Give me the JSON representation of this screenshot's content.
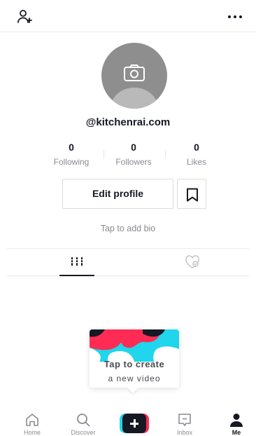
{
  "profile": {
    "username": "@kitchenrai.com",
    "bio_placeholder": "Tap to add bio",
    "edit_button": "Edit profile"
  },
  "stats": [
    {
      "value": "0",
      "label": "Following"
    },
    {
      "value": "0",
      "label": "Followers"
    },
    {
      "value": "0",
      "label": "Likes"
    }
  ],
  "tabs": [
    {
      "icon": "grid-bars-icon",
      "active": true
    },
    {
      "icon": "liked-heart-icon",
      "active": false
    }
  ],
  "create_card": {
    "line1": "Tap to create",
    "line2": "a new video"
  },
  "nav": {
    "items": [
      {
        "label": "Home",
        "icon": "home-icon"
      },
      {
        "label": "Discover",
        "icon": "search-icon"
      },
      {
        "label": "",
        "icon": "plus-icon"
      },
      {
        "label": "Inbox",
        "icon": "inbox-icon"
      },
      {
        "label": "Me",
        "icon": "person-icon"
      }
    ]
  },
  "colors": {
    "text": "#161823",
    "secondary": "#8a8b91",
    "accent_red": "#fe2c55",
    "accent_cyan": "#20d5ec"
  }
}
